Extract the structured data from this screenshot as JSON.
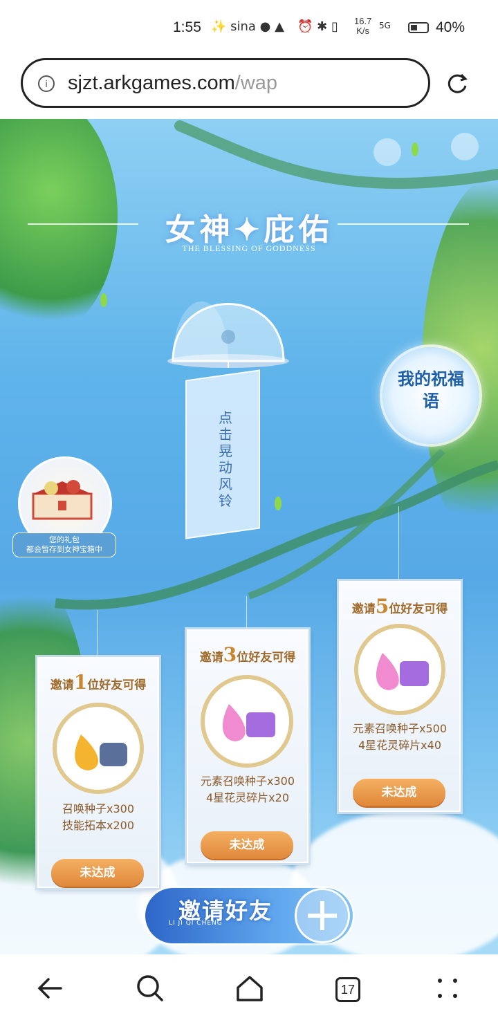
{
  "status_bar": {
    "time": "1:55",
    "notification_icons": "✨ sina ● ▲",
    "right_icons": "⏰ ✱ ▯",
    "speed_value": "16.7",
    "speed_unit": "K/s",
    "network": "5G",
    "battery": "40%"
  },
  "browser": {
    "url_domain": "sjzt.arkgames.com",
    "url_path": "/wap",
    "tab_count": "17"
  },
  "page": {
    "title": "女神✦庇佑",
    "subtitle": "THE BLESSING OF GODDNESS",
    "wind_chime_tag": "点击晃动风铃",
    "blessing_button": "我的祝福语",
    "gift_note": "您的礼包\n都会暂存到女神宝箱中",
    "invite_button": "邀请好友",
    "invite_sub": "LI JI QI CHENG"
  },
  "rewards": [
    {
      "head_prefix": "邀请",
      "count": "1",
      "head_suffix": "位好友可得",
      "line1": "召唤种子x300",
      "line2": "技能拓本x200",
      "status": "未达成"
    },
    {
      "head_prefix": "邀请",
      "count": "3",
      "head_suffix": "位好友可得",
      "line1": "元素召唤种子x300",
      "line2": "4星花灵碎片x20",
      "status": "未达成"
    },
    {
      "head_prefix": "邀请",
      "count": "5",
      "head_suffix": "位好友可得",
      "line1": "元素召唤种子x500",
      "line2": "4星花灵碎片x40",
      "status": "未达成"
    }
  ],
  "colors": {
    "accent": "#e0883a",
    "sky": "#56a9e6",
    "title_brown": "#a06a2a"
  },
  "icons": [
    "info-icon",
    "reload-icon",
    "back-icon",
    "search-icon",
    "home-icon",
    "tabs-icon",
    "menu-icon",
    "plus-icon"
  ]
}
